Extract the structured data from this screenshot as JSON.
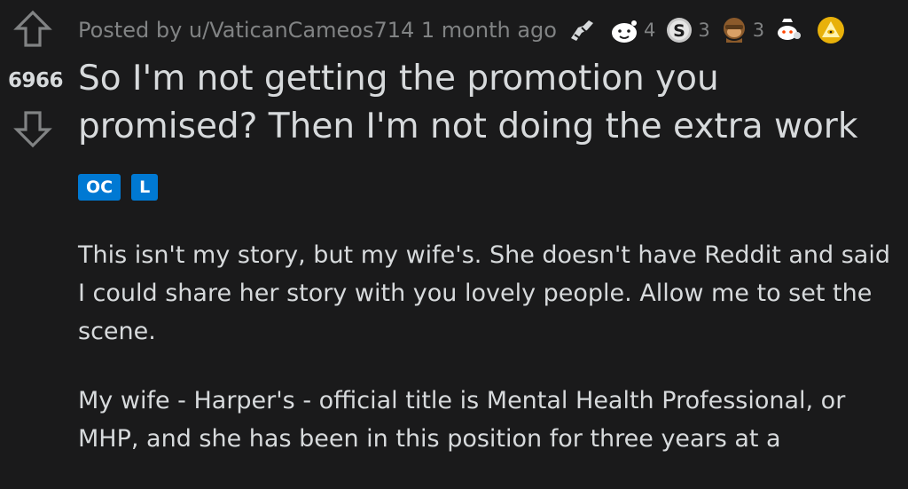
{
  "post": {
    "score": "6966",
    "author_line": "Posted by u/VaticanCameos714 1 month ago",
    "title": "So I'm not getting the promotion you promised? Then I'm not doing the extra work",
    "flairs": [
      "OC",
      "L"
    ],
    "paragraphs": [
      "This isn't my story, but my wife's. She doesn't have Reddit and said I could share her story with you lovely people. Allow me to set the scene.",
      "My wife - Harper's - official title is Mental Health Professional, or MHP, and she has been in this position for three years at a"
    ]
  },
  "awards": [
    {
      "icon": "arm-wrestle-award-icon",
      "count": ""
    },
    {
      "icon": "wholesome-award-icon",
      "count": "4"
    },
    {
      "icon": "silver-award-icon",
      "count": "3"
    },
    {
      "icon": "monkey-award-icon",
      "count": "3"
    },
    {
      "icon": "snoo-award-icon",
      "count": ""
    },
    {
      "icon": "gold-triangle-award-icon",
      "count": ""
    }
  ],
  "colors": {
    "background": "#1a1a1b",
    "text": "#d7dadc",
    "muted": "#818384",
    "flair": "#0079d3"
  }
}
